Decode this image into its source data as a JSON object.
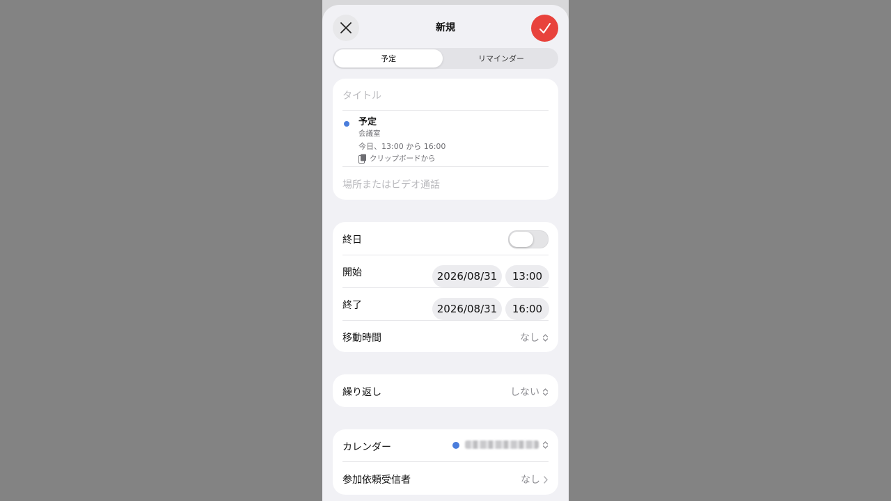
{
  "header": {
    "title": "新規",
    "close_icon": "close-icon",
    "done_icon": "checkmark-icon",
    "accent": "#e8423c"
  },
  "segment": {
    "selected": "予定",
    "other": "リマインダー"
  },
  "event_card": {
    "title_placeholder": "タイトル",
    "suggestion": {
      "name": "予定",
      "location": "会議室",
      "time": "今日、13:00 から 16:00",
      "source": "クリップボードから",
      "source_icon": "clipboard-icon",
      "dot_color": "#4a7ddc"
    },
    "location_placeholder": "場所またはビデオ通話"
  },
  "time_card": {
    "all_day_label": "終日",
    "all_day": false,
    "start_label": "開始",
    "start_date": "2026/08/31",
    "start_time": "13:00",
    "end_label": "終了",
    "end_date": "2026/08/31",
    "end_time": "16:00",
    "travel_label": "移動時間",
    "travel_value": "なし"
  },
  "repeat_card": {
    "label": "繰り返し",
    "value": "しない"
  },
  "calendar_card": {
    "calendar_label": "カレンダー",
    "calendar_dot_color": "#4a7ddc",
    "invitees_label": "参加依頼受信者",
    "invitees_value": "なし"
  }
}
